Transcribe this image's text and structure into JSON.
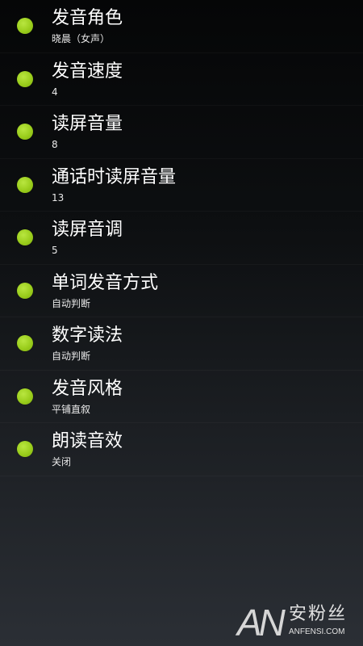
{
  "settings": [
    {
      "title": "发音角色",
      "value": "晓晨（女声）"
    },
    {
      "title": "发音速度",
      "value": "4"
    },
    {
      "title": "读屏音量",
      "value": "8"
    },
    {
      "title": "通话时读屏音量",
      "value": "13"
    },
    {
      "title": "读屏音调",
      "value": "5"
    },
    {
      "title": "单词发音方式",
      "value": "自动判断"
    },
    {
      "title": "数字读法",
      "value": "自动判断"
    },
    {
      "title": "发音风格",
      "value": "平铺直叙"
    },
    {
      "title": "朗读音效",
      "value": "关闭"
    }
  ],
  "watermark": {
    "logo": "AN",
    "name_cn": "安粉丝",
    "domain": "ANFENSI.COM"
  },
  "colors": {
    "bullet": "#9acd1c",
    "background_top": "#050607",
    "background_bottom": "#2b2f35"
  },
  "icons": {
    "bullet": "green-dot-icon"
  }
}
